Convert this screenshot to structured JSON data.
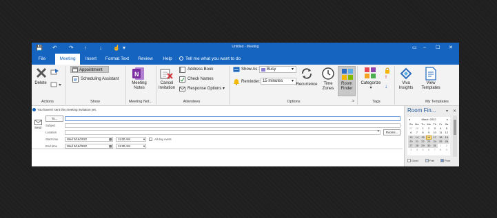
{
  "window": {
    "title": "Untitled - Meeting",
    "quick_access": {
      "save": "💾",
      "undo": "↶",
      "redo": "↷",
      "up": "↑",
      "down": "↓",
      "touch": "☝",
      "more": "▾"
    },
    "controls": {
      "restore": "▭",
      "minimize": "–",
      "maximize": "☐",
      "close": "✕"
    }
  },
  "tabs": [
    "File",
    "Meeting",
    "Insert",
    "Format Text",
    "Review",
    "Help"
  ],
  "tell_me": "Tell me what you want to do",
  "ribbon": {
    "actions": {
      "delete": "Delete",
      "label": "Actions"
    },
    "show": {
      "appointment": "Appointment",
      "scheduling": "Scheduling Assistant",
      "label": "Show"
    },
    "meeting_notes": {
      "button": [
        "Meeting",
        "Notes"
      ],
      "label": "Meeting Not..."
    },
    "attendees": {
      "cancel": [
        "Cancel",
        "Invitation"
      ],
      "address_book": "Address Book",
      "check_names": "Check Names",
      "response_options": "Response Options",
      "label": "Attendees"
    },
    "options": {
      "show_as_label": "Show As:",
      "show_as_value": "Busy",
      "reminder_label": "Reminder:",
      "reminder_value": "15 minutes",
      "recurrence": "Recurrence",
      "time_zones": [
        "Time",
        "Zones"
      ],
      "room_finder": [
        "Room",
        "Finder"
      ],
      "label": "Options"
    },
    "tags": {
      "categorize": "Categorize",
      "label": "Tags"
    },
    "templates": {
      "viva": [
        "Viva",
        "Insights"
      ],
      "view": [
        "View",
        "Templates"
      ],
      "label": "My Templates"
    }
  },
  "form": {
    "info": "You haven't sent this meeting invitation yet.",
    "send": "Send",
    "to": "To...",
    "subject": "Subject",
    "location": "Location",
    "rooms": "Rooms...",
    "start_label": "Start time",
    "start_date": "Wed 3/16/2022",
    "start_time": "11:00 AM",
    "all_day": "All day event",
    "end_label": "End time",
    "end_date": "Wed 3/16/2022",
    "end_time": "11:30 AM"
  },
  "room_finder": {
    "title": "Room Fin...",
    "month": "March 2022",
    "days": [
      "Su",
      "Mo",
      "Tu",
      "We",
      "Th",
      "Fr",
      "Sa"
    ],
    "weeks": [
      [
        "27",
        "28",
        "1",
        "2",
        "3",
        "4",
        "5"
      ],
      [
        "6",
        "7",
        "8",
        "9",
        "10",
        "11",
        "12"
      ],
      [
        "13",
        "14",
        "15",
        "16",
        "17",
        "18",
        "19"
      ],
      [
        "20",
        "21",
        "22",
        "23",
        "24",
        "25",
        "26"
      ],
      [
        "27",
        "28",
        "29",
        "30",
        "31",
        "1",
        "2"
      ],
      [
        "3",
        "4",
        "5",
        "6",
        "7",
        "8",
        "9"
      ]
    ],
    "today": "16",
    "legend": [
      "Good",
      "Fair",
      "Poor"
    ]
  },
  "colors": {
    "title_bar": "#1565c0",
    "ribbon_bg": "#f3f3f3",
    "accent_blue": "#1f5597",
    "onenote_purple": "#7b2fa1",
    "busy_swatch": "#8b7fd6",
    "today": "#ffe08a"
  }
}
